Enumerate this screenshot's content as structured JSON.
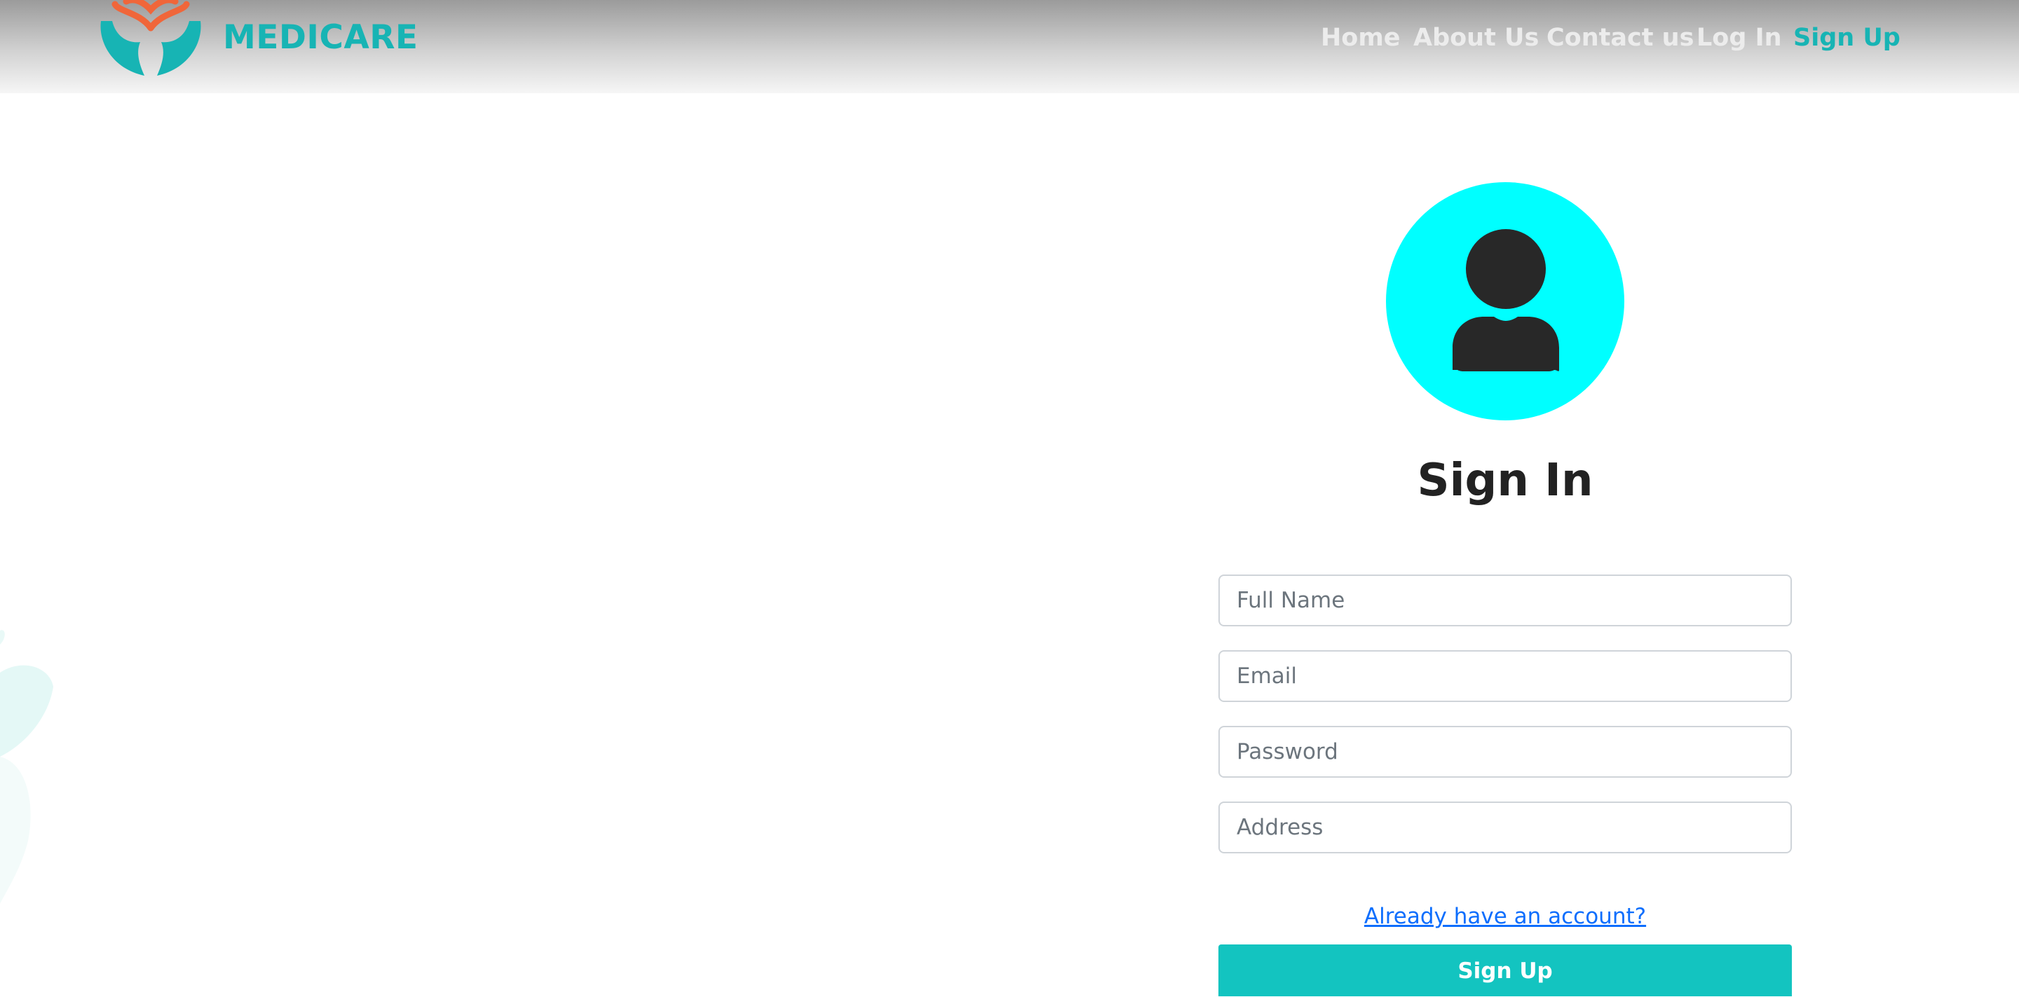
{
  "header": {
    "brand": "MEDICARE",
    "nav": [
      {
        "label": "Home"
      },
      {
        "label": "About Us"
      },
      {
        "label": "Contact us"
      },
      {
        "label": "Log In"
      },
      {
        "label": "Sign Up"
      }
    ],
    "active_nav": "Sign Up"
  },
  "form": {
    "title": "Sign In",
    "fields": [
      {
        "placeholder": "Full Name",
        "value": ""
      },
      {
        "placeholder": "Email",
        "value": ""
      },
      {
        "placeholder": "Password",
        "value": ""
      },
      {
        "placeholder": "Address",
        "value": ""
      }
    ],
    "account_link": "Already have an account?",
    "submit_label": "Sign Up"
  },
  "icons": {
    "logo": "hands-heart-logo-icon",
    "avatar": "user-icon",
    "decoration": "leaf-icon"
  },
  "colors": {
    "brand": "#17b4b4",
    "avatar_bg": "#00ffff",
    "button": "#13c4c0",
    "link": "#0d6efd",
    "nav_text": "#ececec"
  }
}
